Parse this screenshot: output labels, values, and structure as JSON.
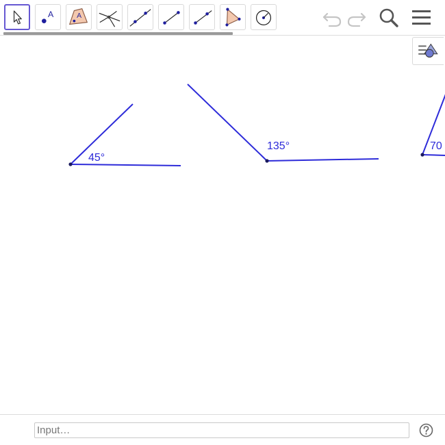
{
  "toolbar": {
    "tools": [
      {
        "name": "move",
        "selected": true
      },
      {
        "name": "point",
        "label": "A"
      },
      {
        "name": "polygon",
        "label": "A"
      },
      {
        "name": "intersect"
      },
      {
        "name": "line"
      },
      {
        "name": "segment"
      },
      {
        "name": "ray"
      },
      {
        "name": "triangle"
      },
      {
        "name": "circle"
      }
    ],
    "undo_icon": "undo-icon",
    "redo_icon": "redo-icon",
    "search_icon": "search-icon",
    "menu_icon": "menu-icon"
  },
  "style_bar": {
    "icon": "style-bar-toggle-icon"
  },
  "graphics": {
    "accent_color": "#2d2bd9",
    "angles": [
      {
        "label": "45°"
      },
      {
        "label": "135°"
      },
      {
        "label": "70"
      }
    ]
  },
  "input_bar": {
    "placeholder": "Input…",
    "help_icon": "help-icon"
  }
}
